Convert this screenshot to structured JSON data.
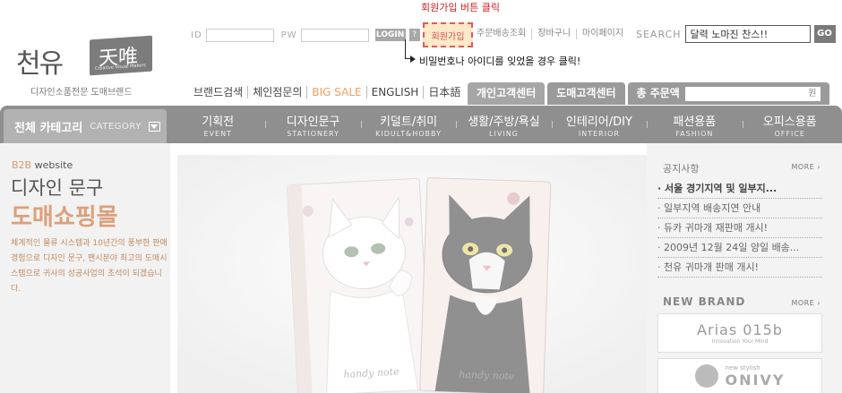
{
  "logo": {
    "name_ko": "천유",
    "name_han": "天唯",
    "tagline": "Creative Visual Makers",
    "caption": "디자인소품전문 도매브랜드"
  },
  "login": {
    "id_label": "ID",
    "pw_label": "PW",
    "login_button": "LOGIN",
    "help_button": "?",
    "join_button": "회원가입"
  },
  "annotations": {
    "join_hint": "회원가입 버튼 클릭",
    "forgot_hint": "비밀번호나 아이디를 잊었을 경우 클릭!"
  },
  "top_links": [
    "주문배송조회",
    "장바구니",
    "마이페이지"
  ],
  "search": {
    "label": "SEARCH",
    "value": "달력 노마진 찬스!!",
    "go": "GO"
  },
  "sub_nav": [
    "브랜드검색",
    "체인점문의",
    "BIG SALE",
    "ENGLISH",
    "日本語"
  ],
  "tabs": {
    "personal": "개인고객센터",
    "wholesale": "도매고객센터",
    "total_label": "총 주문액",
    "total_unit": "원"
  },
  "category": {
    "all_ko": "전체 카테고리",
    "all_en": "CATEGORY",
    "items": [
      {
        "ko": "기획전",
        "en": "EVENT"
      },
      {
        "ko": "디자인문구",
        "en": "STATIONERY"
      },
      {
        "ko": "키덜트/취미",
        "en": "KIDULT&HOBBY"
      },
      {
        "ko": "생활/주방/욕실",
        "en": "LIVING"
      },
      {
        "ko": "인테리어/DIY",
        "en": "INTERIOR"
      },
      {
        "ko": "패션용품",
        "en": "FASHION"
      },
      {
        "ko": "오피스용품",
        "en": "OFFICE"
      }
    ]
  },
  "promo": {
    "b2b": "B2B",
    "website": "website",
    "line1": "디자인 문구",
    "line2": "도매쇼핑몰",
    "desc": "체계적인 물류 시스템과 10년간의 풍부한 판매경험으로 디자인 문구, 팬시분야 최고의 도매시스템으로 귀사의 성공사업의 초석이 되겠습니다."
  },
  "notice": {
    "title": "공지사항",
    "more": "MORE ›",
    "items": [
      "· 서울 경기지역 및 일부지...",
      "· 일부지역 배송지연 안내",
      "· 듀카 귀마개 재판매 개시!",
      "· 2009년 12월 24일 양일 배송...",
      "· 천유 귀마개 판매 개시!"
    ]
  },
  "new_brand": {
    "title": "NEW BRAND",
    "more": "MORE ›",
    "brand1_name": "Arias 015b",
    "brand1_tagline": "Innovation Your Mind",
    "brand2_name": "ONIVY",
    "brand2_small": "new stylish"
  }
}
